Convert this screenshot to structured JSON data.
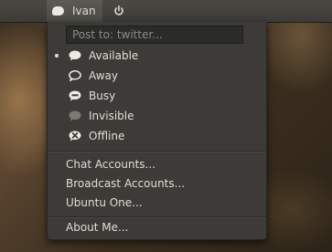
{
  "panel": {
    "user_name": "Ivan",
    "me_icon": "chat-bubble-icon",
    "power_icon": "power-icon"
  },
  "menu": {
    "post_placeholder": "Post to: twitter...",
    "statuses": [
      {
        "label": "Available",
        "icon": "available-icon",
        "selected": true
      },
      {
        "label": "Away",
        "icon": "away-icon",
        "selected": false
      },
      {
        "label": "Busy",
        "icon": "busy-icon",
        "selected": false
      },
      {
        "label": "Invisible",
        "icon": "invisible-icon",
        "selected": false
      },
      {
        "label": "Offline",
        "icon": "offline-icon",
        "selected": false
      }
    ],
    "accounts": [
      "Chat Accounts...",
      "Broadcast Accounts...",
      "Ubuntu One..."
    ],
    "about": "About Me..."
  },
  "colors": {
    "panel": "#3c3b37",
    "menu_bg": "#3c3b37",
    "text": "#e0ddd6"
  }
}
